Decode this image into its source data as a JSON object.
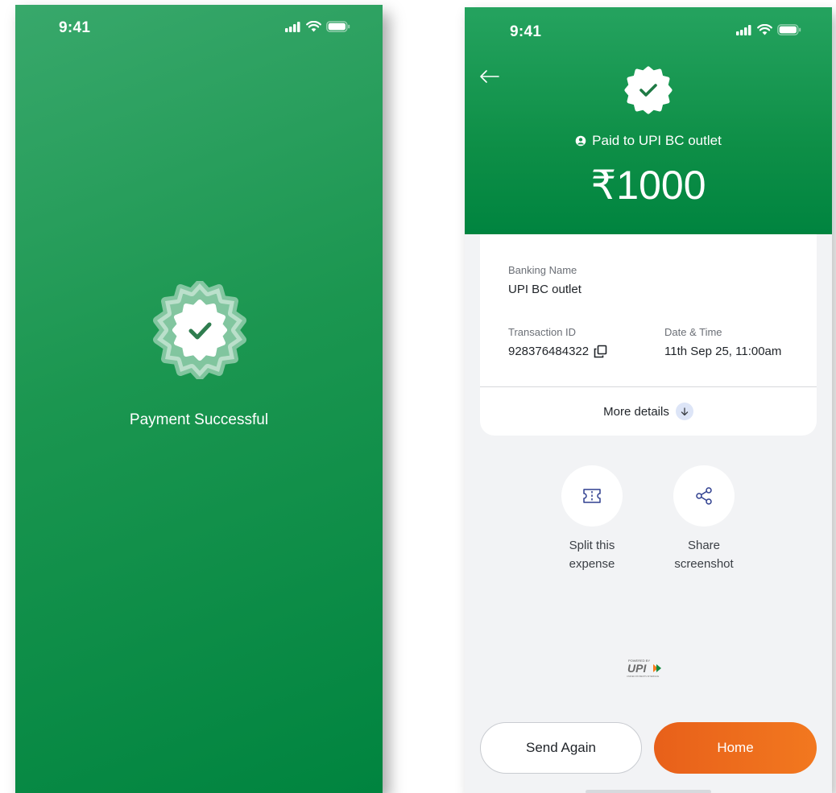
{
  "status": {
    "time": "9:41"
  },
  "success_screen": {
    "title": "Payment Successful"
  },
  "receipt": {
    "paid_to": "Paid to UPI BC outlet",
    "amount": "₹1000",
    "fields": {
      "banking_name_label": "Banking Name",
      "banking_name_value": "UPI BC outlet",
      "transaction_id_label": "Transaction ID",
      "transaction_id_value": "928376484322",
      "datetime_label": "Date & Time",
      "datetime_value": "11th Sep 25, 11:00am"
    },
    "more_details": "More details",
    "actions": {
      "split_line1": "Split this",
      "split_line2": "expense",
      "share_line1": "Share",
      "share_line2": "screenshot"
    },
    "powered_by": "POWERED BY",
    "upi_brand": "UPI",
    "upi_tagline": "UNIFIED PAYMENTS INTERFACE",
    "buttons": {
      "send_again": "Send Again",
      "home": "Home"
    }
  },
  "colors": {
    "brand_green": "#00843f",
    "accent_orange": "#f2781f",
    "more_details_circle": "#dde5f7"
  },
  "icons": [
    "verified-check-icon",
    "back-arrow-icon",
    "user-circle-icon",
    "copy-icon",
    "arrow-down-icon",
    "ticket-split-icon",
    "share-icon",
    "signal-icon",
    "wifi-icon",
    "battery-icon"
  ]
}
